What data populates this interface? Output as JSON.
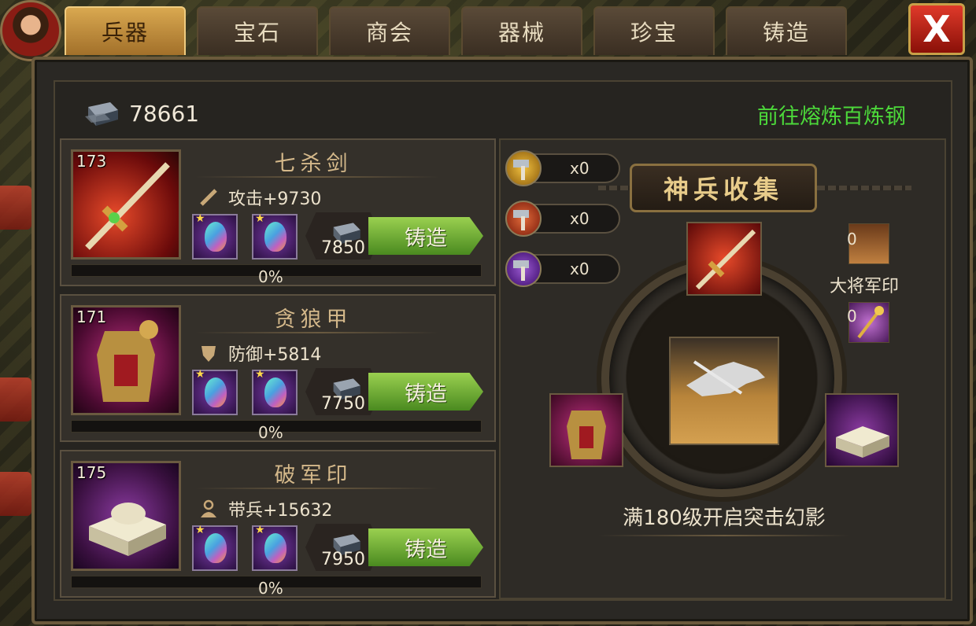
{
  "tabs": [
    {
      "label": "兵器",
      "active": true
    },
    {
      "label": "宝石",
      "active": false
    },
    {
      "label": "商会",
      "active": false
    },
    {
      "label": "器械",
      "active": false
    },
    {
      "label": "珍宝",
      "active": false
    },
    {
      "label": "铸造",
      "active": false
    }
  ],
  "close_label": "X",
  "resource": {
    "icon": "iron-ingot-icon",
    "value": "78661"
  },
  "smelt_link": "前往熔炼百炼钢",
  "items": [
    {
      "level": "173",
      "name": "七杀剑",
      "stat_icon": "sword-stat-icon",
      "stat": "攻击+9730",
      "cost": "7850",
      "forge_label": "铸造",
      "progress_text": "0%",
      "progress": 0
    },
    {
      "level": "171",
      "name": "贪狼甲",
      "stat_icon": "shield-stat-icon",
      "stat": "防御+5814",
      "cost": "7750",
      "forge_label": "铸造",
      "progress_text": "0%",
      "progress": 0
    },
    {
      "level": "175",
      "name": "破军印",
      "stat_icon": "troops-stat-icon",
      "stat": "带兵+15632",
      "cost": "7950",
      "forge_label": "铸造",
      "progress_text": "0%",
      "progress": 0
    }
  ],
  "hammers": [
    {
      "icon": "gold-hammer-icon",
      "count": "x0",
      "color": "#c8901a"
    },
    {
      "icon": "red-hammer-icon",
      "count": "x0",
      "color": "#b8401a"
    },
    {
      "icon": "purple-hammer-icon",
      "count": "x0",
      "color": "#6a2aa0"
    }
  ],
  "collection_title": "神兵收集",
  "side_rewards": {
    "seal_count": "0",
    "seal_name": "大将军印",
    "scepter_count": "0"
  },
  "unlock_text": "满180级开启突击幻影",
  "colors": {
    "accent_green": "#4cd83a",
    "tab_active": "#d9a850",
    "close_red": "#e03a2a"
  }
}
